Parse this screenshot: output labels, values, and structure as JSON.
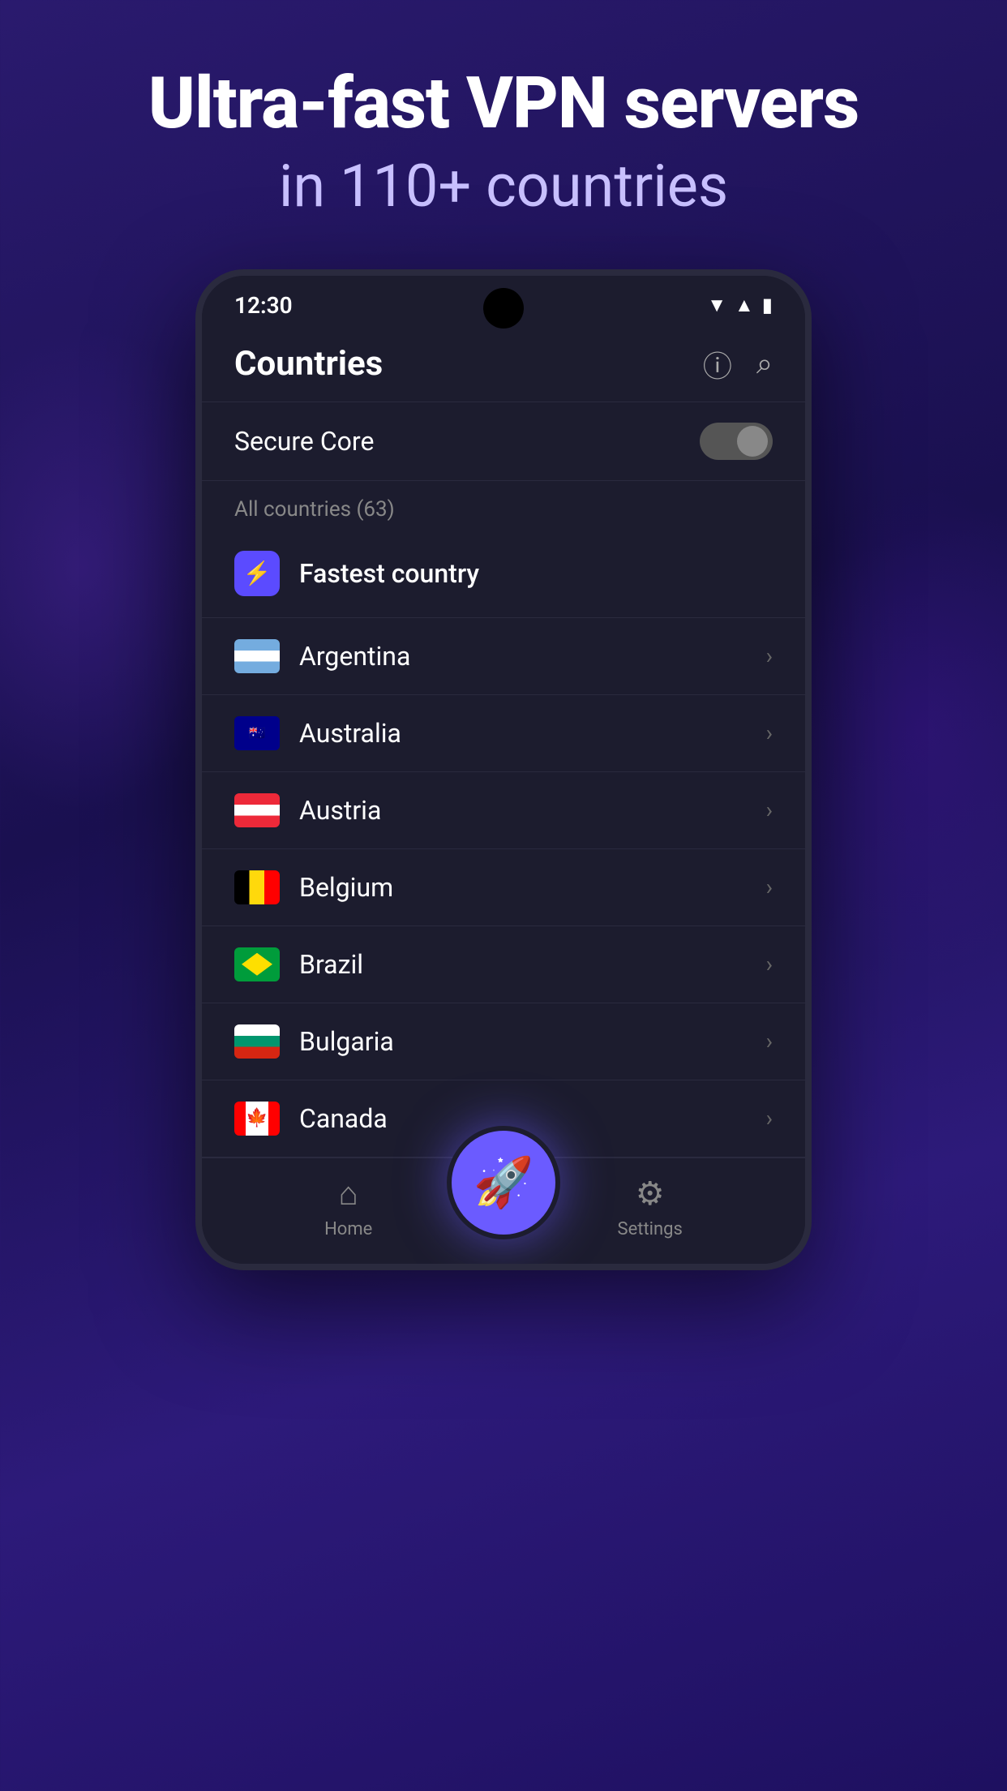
{
  "header": {
    "title_line1": "Ultra-fast VPN servers",
    "title_line2": "in 110+ countries"
  },
  "status_bar": {
    "time": "12:30"
  },
  "app_header": {
    "title": "Countries",
    "info_icon": "ℹ",
    "search_icon": "🔍"
  },
  "secure_core": {
    "label": "Secure Core",
    "toggle_state": "off"
  },
  "section": {
    "label": "All countries (63)"
  },
  "fastest": {
    "label": "Fastest country",
    "icon": "⚡"
  },
  "countries": [
    {
      "name": "Argentina",
      "flag_type": "ar"
    },
    {
      "name": "Australia",
      "flag_type": "au"
    },
    {
      "name": "Austria",
      "flag_type": "at"
    },
    {
      "name": "Belgium",
      "flag_type": "be"
    },
    {
      "name": "Brazil",
      "flag_type": "br"
    },
    {
      "name": "Bulgaria",
      "flag_type": "bg"
    },
    {
      "name": "Canada",
      "flag_type": "ca"
    }
  ],
  "bottom_nav": {
    "home_label": "Home",
    "settings_label": "Settings",
    "fab_icon": "🚀"
  }
}
